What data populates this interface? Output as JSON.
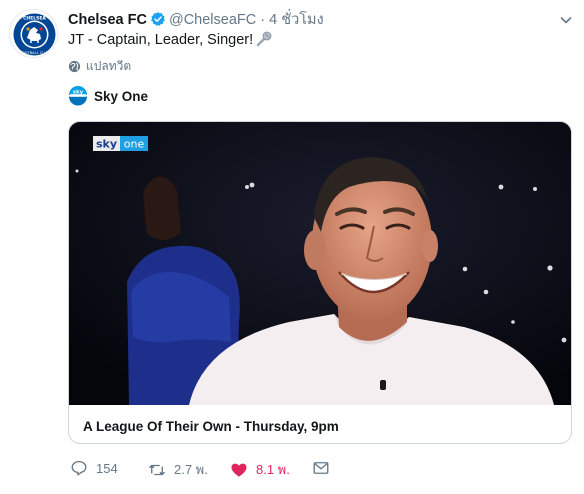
{
  "tweet": {
    "author_name": "Chelsea FC",
    "handle": "@ChelseaFC",
    "separator": "·",
    "time": "4 ชั่วโมง",
    "text": "JT - Captain, Leader, Singer!",
    "translate_label": "แปลทวีต"
  },
  "source": {
    "name": "Sky One"
  },
  "card": {
    "title": "A League Of Their Own - Thursday, 9pm",
    "video_brand_sky": "sky",
    "video_brand_one": "one"
  },
  "actions": {
    "replies": "154",
    "retweets": "2.7 พ.",
    "likes": "8.1 พ."
  },
  "colors": {
    "like_active": "#e0245e",
    "meta_gray": "#657786",
    "verified_blue": "#1da1f2"
  },
  "icons": {
    "verified": "verified-badge-icon",
    "more": "chevron-down-icon",
    "emoji": "microphone-icon",
    "translate": "globe-icon",
    "reply": "reply-icon",
    "retweet": "retweet-icon",
    "like": "heart-icon",
    "dm": "envelope-icon"
  }
}
